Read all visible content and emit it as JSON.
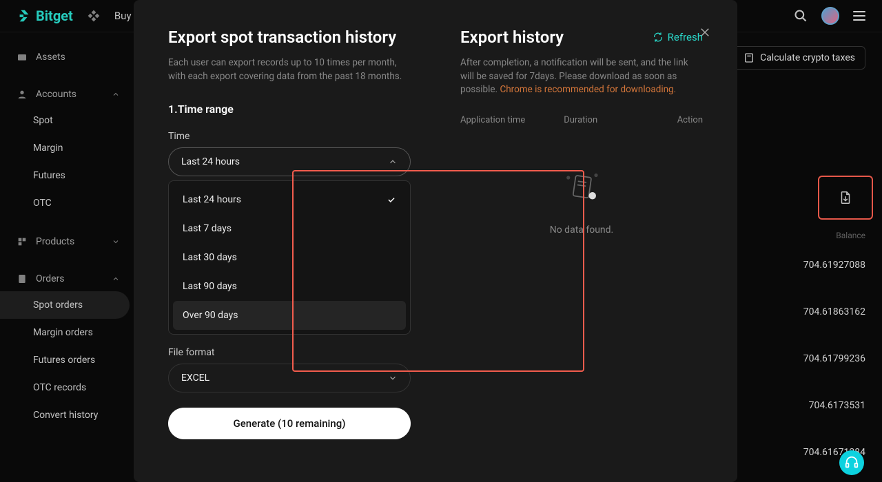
{
  "header": {
    "brand": "Bitget",
    "nav_buy": "Buy"
  },
  "sidebar": {
    "assets": "Assets",
    "accounts": "Accounts",
    "accounts_items": [
      "Spot",
      "Margin",
      "Futures",
      "OTC"
    ],
    "products": "Products",
    "orders": "Orders",
    "orders_items": [
      "Spot orders",
      "Margin orders",
      "Futures orders",
      "OTC records",
      "Convert history"
    ]
  },
  "page": {
    "calc_taxes": "Calculate crypto taxes",
    "balance_label": "Balance",
    "balances": [
      "704.61927088",
      "704.61863162",
      "704.61799236",
      "704.6173531",
      "704.61671384"
    ]
  },
  "modal": {
    "left_title": "Export spot transaction history",
    "left_desc": "Each user can export records up to 10 times per month, with each export covering data from the past 18 months.",
    "step1": "1.Time range",
    "time_label": "Time",
    "time_value": "Last 24 hours",
    "time_options": [
      "Last 24 hours",
      "Last 7 days",
      "Last 30 days",
      "Last 90 days",
      "Over 90 days"
    ],
    "file_label": "File format",
    "file_value": "EXCEL",
    "generate": "Generate (10 remaining)",
    "right_title": "Export history",
    "refresh": "Refresh",
    "right_desc_1": "After completion, a notification will be sent, and the link will be saved for 7days. Please download as soon as possible. ",
    "right_desc_chrome": "Chrome is recommended for downloading.",
    "col_app_time": "Application time",
    "col_duration": "Duration",
    "col_action": "Action",
    "no_data": "No data found."
  }
}
